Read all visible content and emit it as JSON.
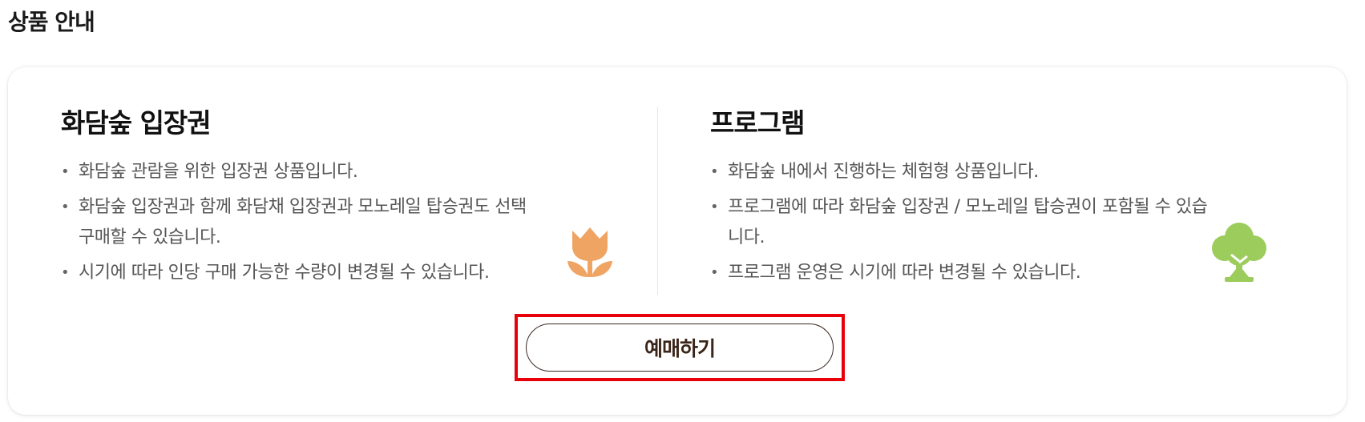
{
  "section": {
    "title": "상품 안내"
  },
  "left_col": {
    "title": "화담숲 입장권",
    "bullets": [
      "화담숲 관람을 위한 입장권 상품입니다.",
      "화담숲 입장권과 함께 화담채 입장권과 모노레일 탑승권도 선택 구매할 수 있습니다.",
      "시기에 따라 인당 구매 가능한 수량이 변경될 수 있습니다."
    ],
    "icon": "tulip-icon",
    "icon_color": "#f0a464"
  },
  "right_col": {
    "title": "프로그램",
    "bullets": [
      "화담숲 내에서 진행하는 체험형 상품입니다.",
      "프로그램에 따라 화담숲 입장권 / 모노레일 탑승권이 포함될 수 있습니다.",
      "프로그램 운영은 시기에 따라 변경될 수 있습니다."
    ],
    "icon": "tree-icon",
    "icon_color": "#9ccc5c"
  },
  "reserve_button": {
    "label": "예매하기",
    "highlight_color": "#e8000b"
  }
}
